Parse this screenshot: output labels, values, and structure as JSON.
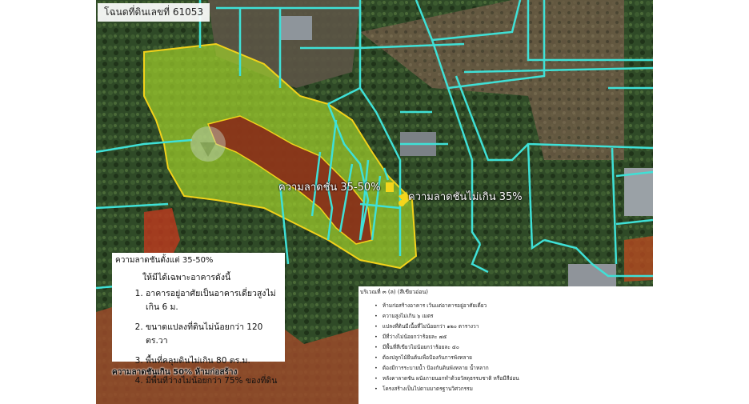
{
  "map": {
    "deed_label": "โฉนดที่ดินเลขที่ 61053",
    "slope_label_steep": "ความลาดชัน 35-50%",
    "slope_label_gentle": "ความลาดชันไม่เกิน 35%",
    "colors": {
      "parcel_lines": "#3fe0d6",
      "slope_35_50": "#9ccc2b",
      "slope_over_50": "#8a1f17",
      "zone_outline": "#f2d21a",
      "marker": "#f4d61c"
    },
    "icons": [
      "pin-marker-icon",
      "map-watermark-icon"
    ]
  },
  "note_box": {
    "heading": "ความลาดชันตั้งแต่ 35-50%",
    "subheading": "ให้มีได้เฉพาะอาคารดังนี้",
    "items": [
      "อาคารอยู่อาศัยเป็นอาคารเดี่ยวสูงไม่เกิน 6 ม.",
      "ขนาดแปลงที่ดินไม่น้อยกว่า 120 ตร.วา",
      "พื้นที่คลุมดินไม่เกิน 80 ตร.ม.",
      "มีพื้นที่ว่างไม่น้อยกว่า 75% ของที่ดิน"
    ],
    "footer": "ความลาดชันเกิน 50% ห้ามก่อสร้าง"
  },
  "regulation_box": {
    "title": "บริเวณที่ ๓ (ล) (สีเขียวอ่อน)",
    "items": [
      "ห้ามก่อสร้างอาคาร เว้นแต่อาคารอยู่อาศัยเดี่ยว",
      "ความสูงไม่เกิน ๖ เมตร",
      "แปลงที่ดินมีเนื้อที่ไม่น้อยกว่า ๑๒๐ ตารางวา",
      "มีที่ว่างไม่น้อยกว่าร้อยละ ๗๕",
      "มีพื้นที่สีเขียวไม่น้อยกว่าร้อยละ ๕๐",
      "ต้องปลูกไม้ยืนต้นเพื่อป้องกันการพังทลาย",
      "ต้องมีการระบายน้ำ ป้องกันดินพังทลาย น้ำหลาก",
      "หลังคาลาดชัน ผนังภายนอกทำด้วยวัสดุธรรมชาติ หรือมีสีอ่อน",
      "โครงสร้างเป็นไปตามมาตรฐานวิศวกรรม"
    ]
  }
}
